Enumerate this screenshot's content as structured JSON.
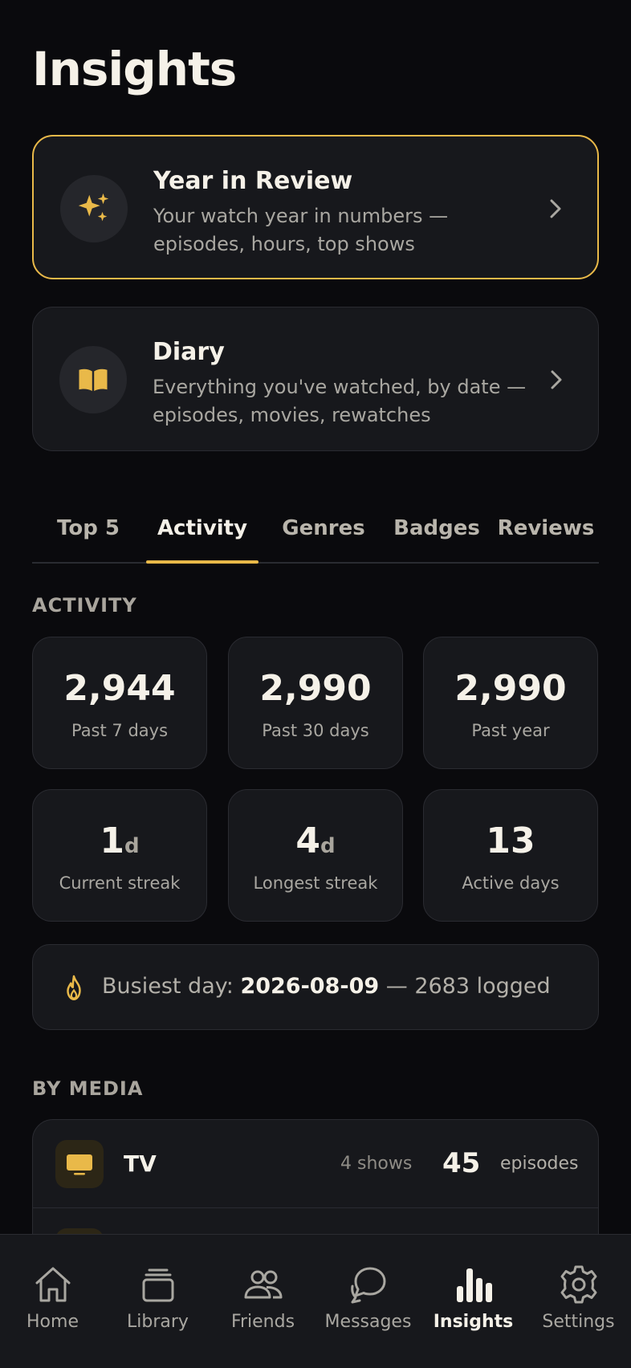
{
  "page": {
    "title": "Insights"
  },
  "cards": [
    {
      "title": "Year in Review",
      "subtitle": "Your watch year in numbers — episodes, hours, top shows",
      "icon": "sparkles-icon"
    },
    {
      "title": "Diary",
      "subtitle": "Everything you've watched, by date — episodes, movies, rewatches",
      "icon": "book-icon"
    }
  ],
  "tabs": [
    "Top 5",
    "Activity",
    "Genres",
    "Badges",
    "Reviews"
  ],
  "active_tab": "Activity",
  "activity": {
    "section_title": "ACTIVITY",
    "stats": [
      {
        "value": "2,944",
        "unit": "",
        "label": "Past 7 days"
      },
      {
        "value": "2,990",
        "unit": "",
        "label": "Past 30 days"
      },
      {
        "value": "2,990",
        "unit": "",
        "label": "Past year"
      },
      {
        "value": "1",
        "unit": "d",
        "label": "Current streak"
      },
      {
        "value": "4",
        "unit": "d",
        "label": "Longest streak"
      },
      {
        "value": "13",
        "unit": "",
        "label": "Active days"
      }
    ],
    "busiest": {
      "prefix": "Busiest day: ",
      "date": "2026-08-09",
      "suffix": " — 2683 logged"
    }
  },
  "by_media": {
    "section_title": "BY MEDIA",
    "rows": [
      {
        "name": "TV",
        "meta": "4 shows",
        "count": "45",
        "unit": "episodes"
      }
    ]
  },
  "nav": [
    {
      "label": "Home",
      "icon": "home-icon"
    },
    {
      "label": "Library",
      "icon": "library-icon"
    },
    {
      "label": "Friends",
      "icon": "friends-icon"
    },
    {
      "label": "Messages",
      "icon": "messages-icon"
    },
    {
      "label": "Insights",
      "icon": "insights-icon"
    },
    {
      "label": "Settings",
      "icon": "settings-icon"
    }
  ],
  "colors": {
    "accent": "#e9b949",
    "background": "#0a0a0d",
    "card": "#17181c"
  }
}
